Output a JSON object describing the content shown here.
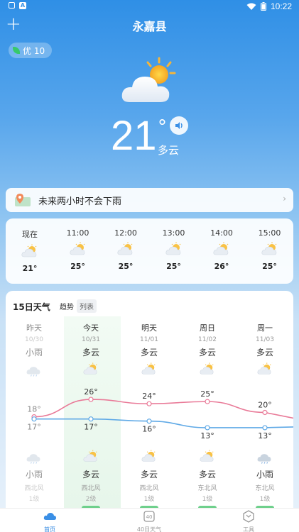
{
  "status_bar": {
    "time": "10:22",
    "left_icons": [
      "box-icon",
      "a-icon"
    ],
    "right_icons": [
      "wifi-icon",
      "battery-icon"
    ]
  },
  "header": {
    "add_icon": "plus-icon",
    "city": "永嘉县"
  },
  "aqi": {
    "label": "优 10",
    "color": "#37c96b"
  },
  "current": {
    "temperature": "21",
    "degree": "°",
    "condition": "多云",
    "icon": "partly-cloudy-icon"
  },
  "rain_forecast": {
    "text": "未来两小时不会下雨",
    "icon": "map-pin-icon"
  },
  "hourly": [
    {
      "time": "现在",
      "temp": "21°"
    },
    {
      "time": "11:00",
      "temp": "25°"
    },
    {
      "time": "12:00",
      "temp": "25°"
    },
    {
      "time": "13:00",
      "temp": "25°"
    },
    {
      "time": "14:00",
      "temp": "26°"
    },
    {
      "time": "15:00",
      "temp": "25°"
    }
  ],
  "daily": {
    "title": "15日天气",
    "tabs": [
      "趋势",
      "列表"
    ],
    "days": [
      {
        "name": "昨天",
        "date": "10/30",
        "cond_day": "小雨",
        "high": "18°",
        "low": "17°",
        "cond_night": "小雨",
        "wind": "西北风",
        "level": "1级"
      },
      {
        "name": "今天",
        "date": "10/31",
        "cond_day": "多云",
        "high": "26°",
        "low": "17°",
        "cond_night": "多云",
        "wind": "西北风",
        "level": "2级"
      },
      {
        "name": "明天",
        "date": "11/01",
        "cond_day": "多云",
        "high": "24°",
        "low": "16°",
        "cond_night": "多云",
        "wind": "西北风",
        "level": "1级"
      },
      {
        "name": "周日",
        "date": "11/02",
        "cond_day": "多云",
        "high": "25°",
        "low": "13°",
        "cond_night": "多云",
        "wind": "东北风",
        "level": "1级"
      },
      {
        "name": "周一",
        "date": "11/03",
        "cond_day": "多云",
        "high": "20°",
        "low": "13°",
        "cond_night": "小雨",
        "wind": "东北风",
        "level": "1级"
      }
    ],
    "high_color": "#e97a98",
    "low_color": "#5fa9e6"
  },
  "chart_data": {
    "type": "line",
    "categories": [
      "昨天",
      "今天",
      "明天",
      "周日",
      "周一"
    ],
    "series": [
      {
        "values": [
          18,
          26,
          24,
          25,
          20
        ]
      },
      {
        "values": [
          17,
          17,
          16,
          13,
          13
        ]
      }
    ]
  },
  "nav": [
    {
      "label": "首页",
      "icon": "home-cloud-icon",
      "active": true
    },
    {
      "label": "40日天气",
      "icon": "calendar-40-icon",
      "active": false
    },
    {
      "label": "工具",
      "icon": "tools-icon",
      "active": false
    }
  ]
}
